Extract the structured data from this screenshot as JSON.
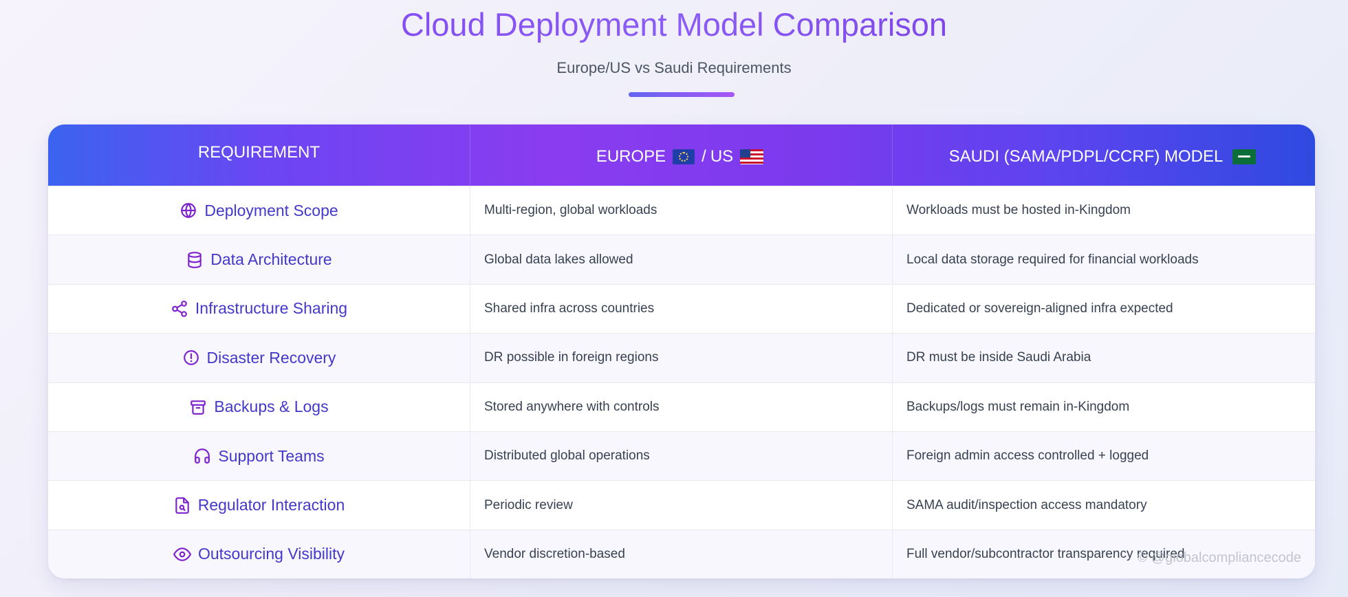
{
  "header": {
    "title": "Cloud Deployment Model Comparison",
    "subtitle": "Europe/US vs Saudi Requirements"
  },
  "table": {
    "columns": {
      "requirement": "REQUIREMENT",
      "europe_label": "EUROPE",
      "europe_sep": "/",
      "us_label": "US",
      "saudi_label": "SAUDI (SAMA/PDPL/CCRF) MODEL"
    },
    "flags": [
      "eu-flag-icon",
      "us-flag-icon",
      "saudi-flag-icon"
    ],
    "rows": [
      {
        "icon": "globe-icon",
        "requirement": "Deployment Scope",
        "europe_us": "Multi-region, global workloads",
        "saudi": "Workloads must be hosted in-Kingdom"
      },
      {
        "icon": "database-icon",
        "requirement": "Data Architecture",
        "europe_us": "Global data lakes allowed",
        "saudi": "Local data storage required for financial workloads"
      },
      {
        "icon": "share-icon",
        "requirement": "Infrastructure Sharing",
        "europe_us": "Shared infra across countries",
        "saudi": "Dedicated or sovereign-aligned infra expected"
      },
      {
        "icon": "alert-circle-icon",
        "requirement": "Disaster Recovery",
        "europe_us": "DR possible in foreign regions",
        "saudi": "DR must be inside Saudi Arabia"
      },
      {
        "icon": "archive-icon",
        "requirement": "Backups & Logs",
        "europe_us": "Stored anywhere with controls",
        "saudi": "Backups/logs must remain in-Kingdom"
      },
      {
        "icon": "headphones-icon",
        "requirement": "Support Teams",
        "europe_us": "Distributed global operations",
        "saudi": "Foreign admin access controlled + logged"
      },
      {
        "icon": "file-search-icon",
        "requirement": "Regulator Interaction",
        "europe_us": "Periodic review",
        "saudi": "SAMA audit/inspection access mandatory"
      },
      {
        "icon": "eye-icon",
        "requirement": "Outsourcing Visibility",
        "europe_us": "Vendor discretion-based",
        "saudi": "Full vendor/subcontractor transparency required"
      }
    ]
  },
  "watermark": "© @globalcompliancecode",
  "colors": {
    "accent": "#7c3aed",
    "requirement_text": "#4338ca",
    "icon": "#7e22ce"
  }
}
